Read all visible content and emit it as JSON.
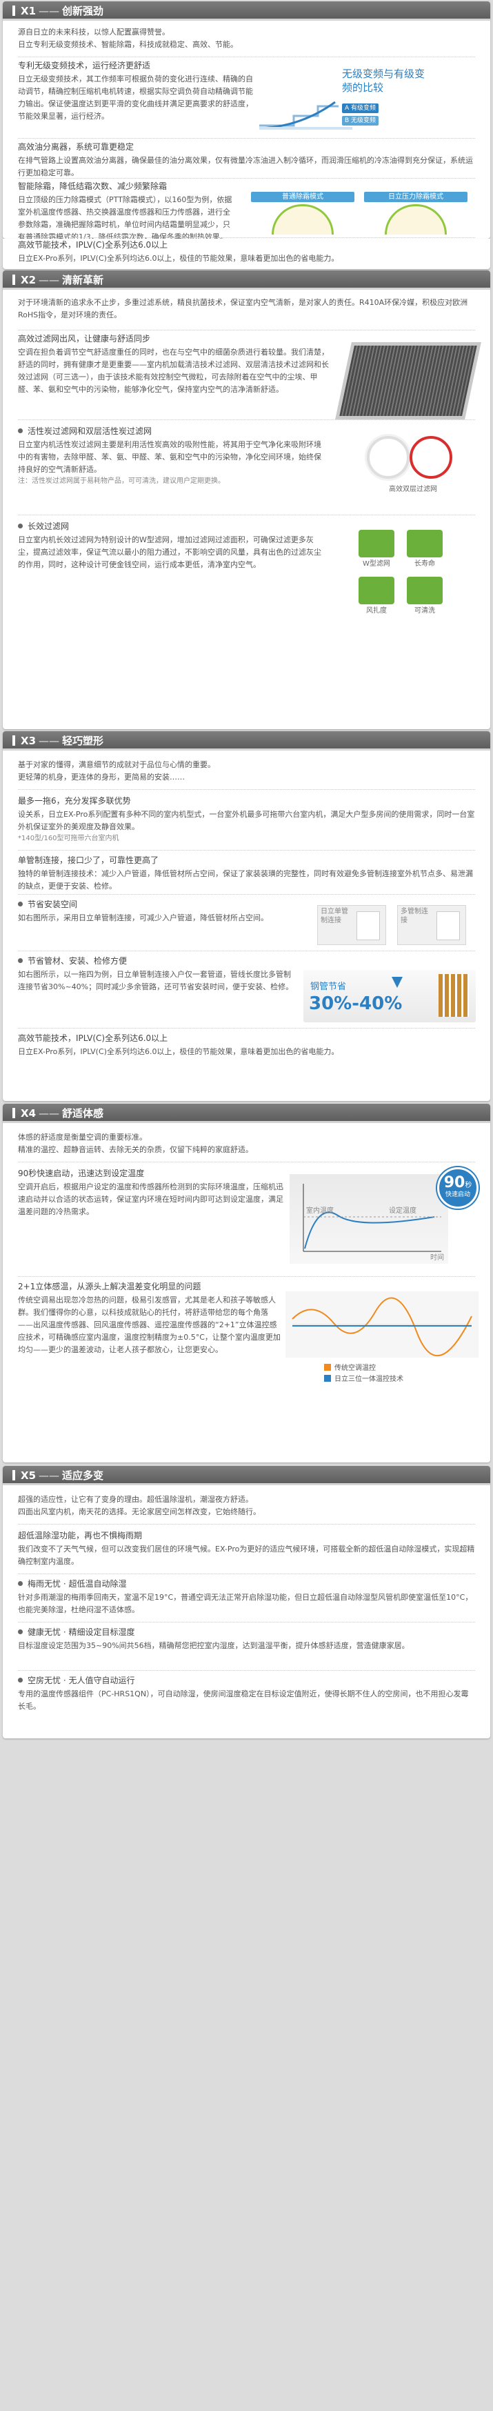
{
  "s1": {
    "num": "X1",
    "title": "创新强劲",
    "p1": "源自日立的未来科技，以惊人配置赢得赞誉。",
    "p2": "日立专利无级变频技术、智能除霜，科技成就稳定、高效、节能。",
    "b1h": "专利无级变频技术，运行经济更舒适",
    "b1": "日立无级变频技术，其工作频率可根据负荷的变化进行连续、精确的自动调节，精确控制压缩机电机转速，根据实际空调负荷自动精确调节能力输出。保证使温度达到更平滑的变化曲线并满足更高要求的舒适度，节能效果显著，运行经济。",
    "bubble": "无级变频与有级变频的比较",
    "leg_a": "有级变频",
    "leg_b": "无级变频",
    "b2h": "高效油分离器，系统可靠更稳定",
    "b2": "在排气管路上设置高效油分离器，确保最佳的油分离效果，仅有微量冷冻油进入制冷循环，而润滑压缩机的冷冻油得到充分保证，系统运行更加稳定可靠。",
    "b3h": "智能除霜，降低结霜次数、减少频繁除霜",
    "b3": "日立顶级的压力除霜模式（PTT除霜模式），以160型为例，依据室外机温度传感器、热交换器温度传感器和压力传感器，进行全参数除霜，准确把握除霜时机，单位时间内结霜量明显减少，只有普通除霜模式的1/3，降低结霜次数，确保冬季的制热效果。",
    "clk_a": "普通除霜模式",
    "clk_b": "日立压力除霜模式",
    "b4h": "高效节能技术，IPLV(C)全系列达6.0以上",
    "b4": "日立EX-Pro系列，IPLV(C)全系列均达6.0以上，极佳的节能效果，意味着更加出色的省电能力。"
  },
  "s2": {
    "num": "X2",
    "title": "清新革新",
    "p1": "对于环境清新的追求永不止步，多重过滤系统，精良抗菌技术，保证室内空气清新，是对家人的责任。R410A环保冷媒，积极应对欧洲RoHS指令，是对环境的责任。",
    "b1h": "高效过滤网出风，让健康与舒适同步",
    "b1": "空调在担负着调节空气舒适度重任的同时，也在与空气中的细菌杂质进行着较量。我们清楚，舒适的同时，拥有健康才是更重要——室内机加载清洁技术过滤网、双层清洁技术过滤网和长效过滤网（可三选一），由于该技术能有效控制空气微粒，可去除附着在空气中的尘埃、甲醛、苯、氨和空气中的污染物，能够净化空气，保持室内空气的洁净清新舒适。",
    "img1cap": "高效双层过滤网",
    "b2h": "活性炭过滤网和双层活性炭过滤网",
    "b2": "日立室内机活性炭过滤网主要是利用活性炭高效的吸附性能，将其用于空气净化来吸附环境中的有害物，去除甲醛、苯、氨、甲醛、苯、氨和空气中的污染物，净化空间环境，始终保持良好的空气清新舒适。",
    "b2note": "注：活性炭过滤网属于易耗物产品，可可清洗，建议用户定期更换。",
    "b3h": "长效过滤网",
    "b3": "日立室内机长效过滤网为特别设计的W型滤网，增加过滤网过滤面积，可确保过滤更多灰尘，提高过滤效率，保证气流以最小的阻力通过，不影响空调的风量，具有出色的过滤灰尘的作用，同时，这种设计可使金钱空间，运行成本更低，清净室内空气。",
    "ic1": "W型滤网",
    "ic2": "长寿命",
    "ic3": "风扎度",
    "ic4": "可清洗"
  },
  "s3": {
    "num": "X3",
    "title": "轻巧塑形",
    "p1": "基于对家的懂得，满意细节的成就对于品位与心情的重要。",
    "p2": "更轻薄的机身，更连体的身形，更简易的安装……",
    "b1h": "最多一拖6，充分发挥多联优势",
    "b1": "设关系，日立EX-Pro系列配置有多种不同的室内机型式，一台室外机最多可拖带六台室内机，满足大户型多房间的使用需求，同时一台室外机保证室外的美观度及静音效果。",
    "b1note": "*140型/160型可拖带六台室内机",
    "b2h": "单管制连接，接口少了，可靠性更高了",
    "b2": "独特的单管制连接技术：减少入户管道，降低管材所占空间，保证了家装装璜的完整性，同时有效避免多管制连接室外机节点多、易泄漏的缺点，更便于安装、检修。",
    "b3h": "节省安装空间",
    "b3": "如右图所示，采用日立单管制连接，可减少入户管道，降低管材所占空间。",
    "pipe_a": "日立单管制连接",
    "pipe_b": "多管制连接",
    "b4h": "节省管材、安装、检修方便",
    "b4": "如右图所示，以一拖四为例，日立单管制连接入户仅一套管道，管线长度比多管制连接节省30%~40%；同时减少多余管路，还可节省安装时间，便于安装、检修。",
    "save_label": "钢管节省",
    "save_val": "30%-40%",
    "b5h": "高效节能技术，IPLV(C)全系列达6.0以上",
    "b5": "日立EX-Pro系列，IPLV(C)全系列均达6.0以上，极佳的节能效果，意味着更加出色的省电能力。"
  },
  "s4": {
    "num": "X4",
    "title": "舒适体感",
    "p1": "体感的舒适度是衡量空调的重要标准。",
    "p2": "精准的温控、超静音运转、去除无关的杂质，仅留下纯粹的家庭舒适。",
    "b1h": "90秒快速启动，迅速达到设定温度",
    "b1": "空调开启后，根据用户设定的温度和传感器所检测到的实际环境温度，压缩机迅速启动并以合适的状态运转，保证室内环境在短时间内即可达到设定温度，满足温差问题的冷热需求。",
    "badge_num": "90",
    "badge_unit": "秒",
    "badge_text": "快速启动",
    "c1_l1": "室内温度",
    "c1_l2": "设定温度",
    "c1_l3": "时间",
    "b2h": "2+1立体感温，从源头上解决温差变化明显的问题",
    "b2": "传统空调易出现忽冷忽热的问题，极易引发感冒，尤其是老人和孩子等敏感人群。我们懂得你的心意，以科技成就贴心的托付，将舒适带给您的每个角落——出风温度传感器、回风温度传感器、遥控温度传感器的“2+1”立体温控感应技术，可精确感应室内温度，温度控制精度为±0.5°C，让整个室内温度更加均匀——更少的温差波动，让老人孩子都放心，让您更安心。",
    "leg1": "传统空调温控",
    "leg2": "日立三位一体温控技术"
  },
  "s5": {
    "num": "X5",
    "title": "适应多变",
    "p1": "超强的适应性，让它有了变身的理由。超低温除湿机，潮湿夜方舒适。",
    "p2": "四面出风室内机，南天花的选择。无论家居空间怎样改变，它始终随行。",
    "b1h": "超低温除湿功能，再也不惧梅雨期",
    "b1": "我们改变不了天气气候，但可以改变我们居住的环境气候。EX-Pro为更好的适应气候环境，可搭载全新的超低温自动除湿模式，实现超精确控制室内温度。",
    "b2h": "梅雨无忧 · 超低温自动除湿",
    "b2": "针对多雨潮湿的梅雨季回南天，室温不足19°C，普通空调无法正常开启除湿功能，但日立超低温自动除湿型风管机即使室温低至10°C，也能完美除湿，杜绝闷湿不适体感。",
    "b3h": "健康无忧 · 精细设定目标湿度",
    "b3": "目标湿度设定范围为35~90%间共56档，精确帮您把控室内湿度，达到温湿平衡，提升体感舒适度，营造健康家居。",
    "b4h": "空房无忧 · 无人值守自动运行",
    "b4": "专用的温度传感器组件（PC-HRS1QN），可自动除湿，使房间湿度稳定在目标设定值附近，使得长期不住人的空房间，也不用担心发霉长毛。"
  },
  "colors": {
    "accent": "#2c7fc1",
    "green": "#5a9e2f",
    "orange": "#f08a1c"
  }
}
